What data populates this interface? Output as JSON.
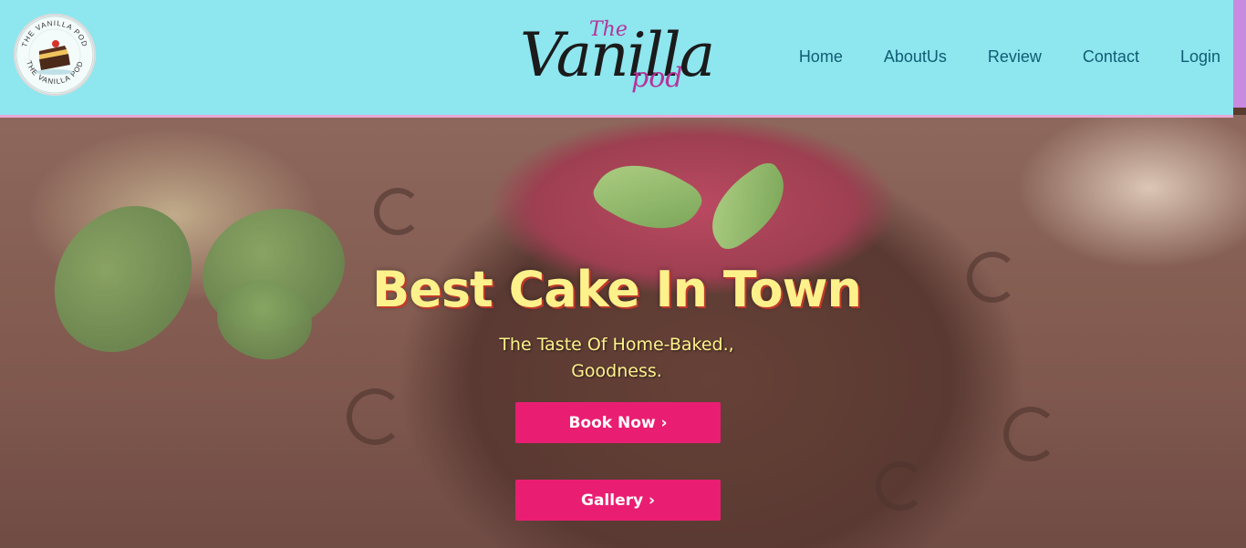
{
  "header": {
    "logo_text_top": "THE VANILLA POD",
    "logo_text_bottom": "THE VANILLA POD",
    "brand_the": "The",
    "brand_main": "Vanilla",
    "brand_pod": "pod"
  },
  "nav": {
    "items": [
      {
        "label": "Home"
      },
      {
        "label": "AboutUs"
      },
      {
        "label": "Review"
      },
      {
        "label": "Contact"
      },
      {
        "label": "Login"
      }
    ]
  },
  "hero": {
    "title": "Best Cake In Town",
    "subtitle": "The Taste Of Home-Baked., Goodness.",
    "primary_button": "Book Now ›",
    "secondary_button": "Gallery ›"
  },
  "colors": {
    "header_bg": "#8ee6ef",
    "nav_text": "#0f5d73",
    "brand_accent": "#b6339a",
    "button_bg": "#e91e72",
    "hero_text": "#fdf18b"
  },
  "icons": {
    "logo": "cake-slice-logo-icon",
    "button_arrow": "chevron-right-icon"
  }
}
